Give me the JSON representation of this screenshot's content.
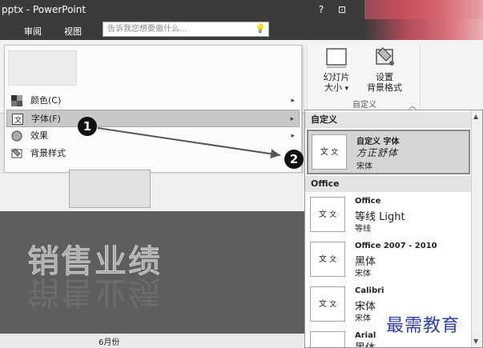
{
  "window": {
    "title": "pptx - PowerPoint",
    "help_icon": "?",
    "ribbon_display_icon": "⊡"
  },
  "ribbon_tabs": [
    {
      "label": "审阅"
    },
    {
      "label": "视图"
    }
  ],
  "search": {
    "placeholder": "告诉我您想要做什么..."
  },
  "customize_group": {
    "slide_size_label": "幻灯片\n大小",
    "slide_size_dropdown": "▾",
    "format_bg_label": "设置\n背景格式",
    "group_label": "自定义",
    "collapse_icon": "︿"
  },
  "variant_menu": {
    "items": [
      {
        "label": "颜色(C)",
        "icon": "color-swatch-icon",
        "has_submenu": true
      },
      {
        "label": "字体(F)",
        "icon": "font-icon",
        "has_submenu": true,
        "highlighted": true
      },
      {
        "label": "效果",
        "icon": "effects-icon",
        "has_submenu": true
      },
      {
        "label": "背景样式",
        "icon": "background-style-icon",
        "has_submenu": true
      }
    ]
  },
  "slide": {
    "title": "销售业绩",
    "month_label": "6月份"
  },
  "fonts_gallery": {
    "custom_section": "自定义",
    "office_section": "Office",
    "preview_text": "文",
    "preview_text_small": "文",
    "custom_font": {
      "name": "自定义 字体",
      "heading": "方正舒体",
      "body": "宋体"
    },
    "office_fonts": [
      {
        "name": "Office",
        "heading": "等线 Light",
        "body": "等线"
      },
      {
        "name": "Office 2007 - 2010",
        "heading": "黑体",
        "body": "宋体"
      },
      {
        "name": "Calibri",
        "heading": "宋体",
        "body": "宋体"
      },
      {
        "name": "Arial",
        "heading": "黑体",
        "body": ""
      }
    ]
  },
  "callouts": [
    {
      "label": "1"
    },
    {
      "label": "2"
    }
  ],
  "watermark": "最需教育",
  "colors": {
    "title_bar": "#3b3b3b",
    "callout": "#111111",
    "watermark": "#2d3fa8"
  }
}
